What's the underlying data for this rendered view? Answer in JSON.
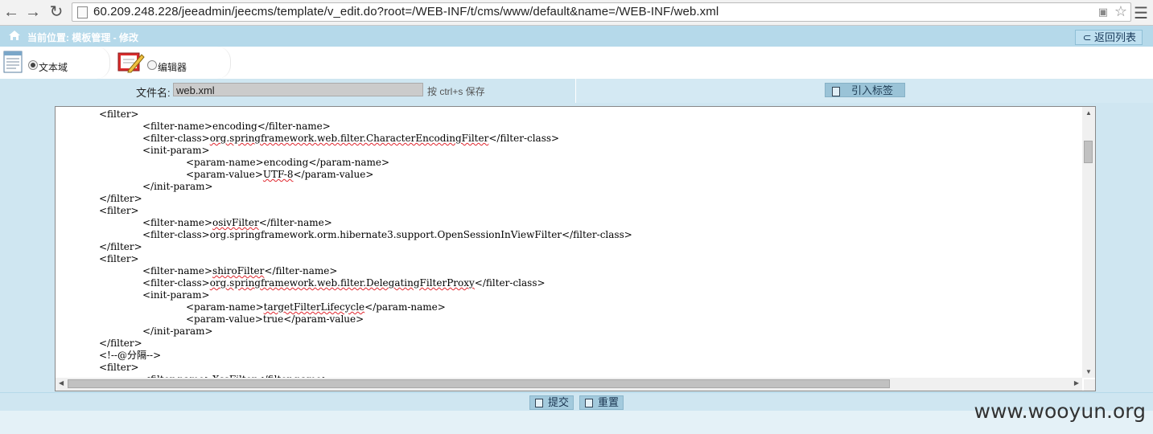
{
  "browser": {
    "url": "60.209.248.228/jeeadmin/jeecms/template/v_edit.do?root=/WEB-INF/t/cms/www/default&name=/WEB-INF/web.xml",
    "icons": [
      "back-icon",
      "forward-icon",
      "reload-icon",
      "page-icon",
      "translate-icon",
      "star-icon",
      "menu-icon"
    ]
  },
  "location": {
    "text": "当前位置: 模板管理 - 修改",
    "back_button": "返回列表"
  },
  "modes": {
    "textarea_label": "文本域",
    "editor_label": "编辑器",
    "selected": "textarea"
  },
  "file": {
    "label": "文件名:",
    "value": "web.xml",
    "hint": "按 ctrl+s 保存",
    "insert_tag_button": "引入标签"
  },
  "editor": {
    "lines": [
      {
        "indent": 1,
        "text": "<filter>"
      },
      {
        "indent": 2,
        "pre": "<filter-name>",
        "mid": "encoding",
        "post": "</filter-name>",
        "spell": false
      },
      {
        "indent": 2,
        "pre": "<filter-class>",
        "mid": "org.springframework.web.filter.CharacterEncodingFilter",
        "post": "</filter-class>",
        "spell": true
      },
      {
        "indent": 2,
        "text": "<init-param>"
      },
      {
        "indent": 3,
        "pre": "<param-name>",
        "mid": "encoding",
        "post": "</param-name>",
        "spell": false
      },
      {
        "indent": 3,
        "pre": "<param-value>",
        "mid": "UTF-8",
        "post": "</param-value>",
        "spell": true
      },
      {
        "indent": 2,
        "text": "</init-param>"
      },
      {
        "indent": 1,
        "text": "</filter>"
      },
      {
        "indent": 1,
        "text": "<filter>"
      },
      {
        "indent": 2,
        "pre": "<filter-name>",
        "mid": "osivFilter",
        "post": "</filter-name>",
        "spell": true
      },
      {
        "indent": 2,
        "pre": "<filter-class>",
        "mid": "org.springframework.orm.hibernate3.support.OpenSessionInViewFilter",
        "post": "</filter-class>",
        "spell": false
      },
      {
        "indent": 1,
        "text": "</filter>"
      },
      {
        "indent": 1,
        "text": "<filter>"
      },
      {
        "indent": 2,
        "pre": "<filter-name>",
        "mid": "shiroFilter",
        "post": "</filter-name>",
        "spell": true
      },
      {
        "indent": 2,
        "pre": "<filter-class>",
        "mid": "org.springframework.web.filter.DelegatingFilterProxy",
        "post": "</filter-class>",
        "spell": true
      },
      {
        "indent": 2,
        "text": "<init-param>"
      },
      {
        "indent": 3,
        "pre": "<param-name>",
        "mid": "targetFilterLifecycle",
        "post": "</param-name>",
        "spell": true
      },
      {
        "indent": 3,
        "pre": "<param-value>",
        "mid": "true",
        "post": "</param-value>",
        "spell": false
      },
      {
        "indent": 2,
        "text": "</init-param>"
      },
      {
        "indent": 1,
        "text": "</filter>"
      },
      {
        "indent": 1,
        "text": "<!--@分隔-->"
      },
      {
        "indent": 1,
        "text": "<filter>"
      },
      {
        "indent": 2,
        "text": "<filter-name>XssFilter</filter-name>"
      }
    ]
  },
  "actions": {
    "submit": "提交",
    "reset": "重置"
  },
  "watermark": "www.wooyun.org"
}
